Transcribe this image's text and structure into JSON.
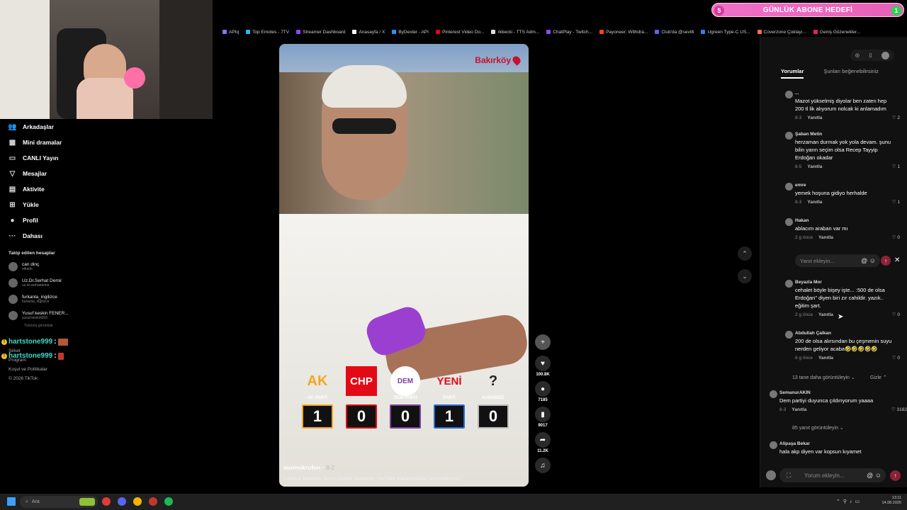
{
  "goal": {
    "left": "5",
    "title": "GÜNLÜK ABONE HEDEFİ",
    "right": "1"
  },
  "bookmarks": [
    {
      "label": "APIq",
      "color": "#7a7aff"
    },
    {
      "label": "Top Emotes - 7TV",
      "color": "#29b6f6"
    },
    {
      "label": "Streamer Dashboard",
      "color": "#9146ff"
    },
    {
      "label": "Anasayfa / X",
      "color": "#ffffff"
    },
    {
      "label": "ByDexter - API",
      "color": "#2196f3"
    },
    {
      "label": "Pinterest Video Do...",
      "color": "#e60023"
    },
    {
      "label": "rkbecki - TTS Adm...",
      "color": "#dddddd"
    },
    {
      "label": "ChatPlay - Twitch...",
      "color": "#9146ff"
    },
    {
      "label": "Payoneer: Withdra...",
      "color": "#ff4800"
    },
    {
      "label": "Club'da @sevilli",
      "color": "#5865f2"
    },
    {
      "label": "Ugreen Type-C US...",
      "color": "#2f80ed"
    },
    {
      "label": "Coverzone Çoklayı...",
      "color": "#ff7043"
    },
    {
      "label": "Geniş Gözenekler...",
      "color": "#e91e63"
    }
  ],
  "sidebar": {
    "nav": [
      {
        "icon": "friends-icon",
        "glyph": "👥",
        "label": "Arkadaşlar"
      },
      {
        "icon": "mini-drama-icon",
        "glyph": "▦",
        "label": "Mini dramalar"
      },
      {
        "icon": "live-icon",
        "glyph": "▭",
        "label": "CANLI Yayın"
      },
      {
        "icon": "messages-icon",
        "glyph": "▽",
        "label": "Mesajlar"
      },
      {
        "icon": "activity-icon",
        "glyph": "▤",
        "label": "Aktivite"
      },
      {
        "icon": "upload-icon",
        "glyph": "⊞",
        "label": "Yükle"
      },
      {
        "icon": "profile-icon",
        "glyph": "●",
        "label": "Profil"
      },
      {
        "icon": "more-icon",
        "glyph": "···",
        "label": "Dahası"
      }
    ],
    "following_title": "Takip edilen hesaplar",
    "following": [
      {
        "name": "can dinç",
        "handle": "stfuide"
      },
      {
        "name": "Uz.Dr.Serhat Demir",
        "handle": "uz.dr.serhatdemir"
      },
      {
        "name": "furkanla_ingilizce",
        "handle": "furkanla_ingilizce"
      },
      {
        "name": "Yusuf keskin FENER...",
        "handle": "yusuf.keskin093"
      }
    ],
    "hidden_line": "Tümünü görüntüle",
    "footer": [
      "Şirket",
      "Program",
      "Koşul ve Politikalar",
      "© 2026 TikTok"
    ]
  },
  "chat": [
    {
      "user": "hartstone999",
      "sep": ":"
    },
    {
      "user": "hartstone999",
      "sep": ":"
    }
  ],
  "video": {
    "location": "Bakırköy",
    "author": "mormikrofon",
    "date": "8-2",
    "caption": "İstanbul Bakırköy Seçim Anketi-Tamamını YouTube Kanalımızdan İzleyebilirsiniz.",
    "parties": [
      {
        "logo": "AK",
        "label": "AK PARTİ",
        "count": "1",
        "color": "#f5a623",
        "border": "#f5a623"
      },
      {
        "logo": "CHP",
        "label": "",
        "count": "0",
        "color": "#e30a17",
        "border": "#e30a17"
      },
      {
        "logo": "DEM",
        "label": "DEM PARTİ",
        "count": "0",
        "color": "#7b3fa0",
        "border": "#7b3fa0"
      },
      {
        "logo": "YENİ",
        "label": "PARTİ",
        "count": "1",
        "color": "#e30a17",
        "border": "#2c6bd6"
      },
      {
        "logo": "?",
        "label": "KARARSIZ",
        "count": "0",
        "color": "#222222",
        "border": "#bbbbbb"
      }
    ]
  },
  "actions": [
    {
      "icon": "avatar-follow-icon",
      "glyph": "+",
      "count": ""
    },
    {
      "icon": "heart-icon",
      "glyph": "♥",
      "count": "100.8K"
    },
    {
      "icon": "comment-icon",
      "glyph": "●",
      "count": "7185"
    },
    {
      "icon": "bookmark-icon",
      "glyph": "▮",
      "count": "9017"
    },
    {
      "icon": "share-icon",
      "glyph": "➦",
      "count": "11.2K"
    },
    {
      "icon": "sound-icon",
      "glyph": "♫",
      "count": ""
    }
  ],
  "comments_tabs": {
    "active": "Yorumlar",
    "other": "Şunları beğenebilirsiniz"
  },
  "comments": [
    {
      "author": "...",
      "text": "Mazot yükselmiş diyolar ben zaten hep 200 tl lik alıyorum nolcak ki anlamadım",
      "date": "8-3",
      "reply": "Yanıtla",
      "likes": "2"
    },
    {
      "author": "Şaban Metin",
      "text": "herzaman durmak yok yola devam. şunu bilin yarın seçim olsa Recep Tayyip Erdoğan okadar",
      "date": "8-5",
      "reply": "Yanıtla",
      "likes": "1"
    },
    {
      "author": "emre",
      "text": "yemek hoşuna gidiyo herhalde",
      "date": "8-3",
      "reply": "Yanıtla",
      "likes": "1"
    },
    {
      "author": "Hakan",
      "text": "ablacım araban var mı",
      "date": "2 g önce",
      "reply": "Yanıtla",
      "likes": "0"
    },
    {
      "author": "Beyazla Mor",
      "text": "cehalet böyle bişey işte... :500 de olsa Erdoğan\" diyen biri zır cahildir. yazık.. eğitim şart.",
      "date": "2 g önce",
      "reply": "Yanıtla",
      "likes": "0"
    },
    {
      "author": "Abdullah Çalkan",
      "text": "200 de olsa alırsından bu çeşmenin suyu nerden geliyor acaba🤣🤣🤣🤣🤣",
      "date": "6 g önce",
      "reply": "Yanıtla",
      "likes": "0"
    },
    {
      "author": "SemanurAKIN",
      "text": "Dem partiyi duyunca çıldırıyorum yaaaa",
      "date": "8-3",
      "reply": "Yanıtla",
      "likes": "3182"
    },
    {
      "author": "Alipaşa Bekar",
      "text": "hala akp diyen var kopsun kıyamet",
      "date": "",
      "reply": "",
      "likes": ""
    }
  ],
  "more_replies_1": "13 tane daha görüntüleyin ⌄",
  "hide": "Gizle ⌃",
  "more_replies_2": "85 yanıt görüntüleyin ⌄",
  "reply_placeholder": "Yanıt ekleyin...",
  "comment_placeholder": "Yorum ekleyin...",
  "taskbar": {
    "search": "Ara",
    "time": "13:11",
    "date": "14.08.2026"
  }
}
